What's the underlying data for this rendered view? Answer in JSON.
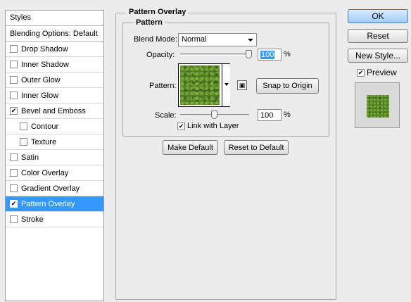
{
  "styles_panel": {
    "header": "Styles",
    "blending_options": "Blending Options: Default",
    "items": [
      {
        "label": "Drop Shadow",
        "checked": false,
        "indent": false,
        "selected": false
      },
      {
        "label": "Inner Shadow",
        "checked": false,
        "indent": false,
        "selected": false
      },
      {
        "label": "Outer Glow",
        "checked": false,
        "indent": false,
        "selected": false
      },
      {
        "label": "Inner Glow",
        "checked": false,
        "indent": false,
        "selected": false
      },
      {
        "label": "Bevel and Emboss",
        "checked": true,
        "indent": false,
        "selected": false
      },
      {
        "label": "Contour",
        "checked": false,
        "indent": true,
        "selected": false
      },
      {
        "label": "Texture",
        "checked": false,
        "indent": true,
        "selected": false
      },
      {
        "label": "Satin",
        "checked": false,
        "indent": false,
        "selected": false
      },
      {
        "label": "Color Overlay",
        "checked": false,
        "indent": false,
        "selected": false
      },
      {
        "label": "Gradient Overlay",
        "checked": false,
        "indent": false,
        "selected": false
      },
      {
        "label": "Pattern Overlay",
        "checked": true,
        "indent": false,
        "selected": true
      },
      {
        "label": "Stroke",
        "checked": false,
        "indent": false,
        "selected": false
      }
    ]
  },
  "pattern_overlay": {
    "group_title": "Pattern Overlay",
    "subgroup_title": "Pattern",
    "blend_mode_label": "Blend Mode:",
    "blend_mode_value": "Normal",
    "opacity_label": "Opacity:",
    "opacity_value": "100",
    "opacity_unit": "%",
    "opacity_level": 1.0,
    "pattern_label": "Pattern:",
    "snap_to_origin": "Snap to Origin",
    "scale_label": "Scale:",
    "scale_value": "100",
    "scale_unit": "%",
    "link_with_layer": "Link with Layer",
    "link_checked": true,
    "make_default": "Make Default",
    "reset_to_default": "Reset to Default"
  },
  "dialog_buttons": {
    "ok": "OK",
    "reset": "Reset",
    "new_style": "New Style...",
    "preview_label": "Preview",
    "preview_checked": true
  },
  "colors": {
    "selection": "#3399ff",
    "pattern_green": "#4f7f24"
  }
}
